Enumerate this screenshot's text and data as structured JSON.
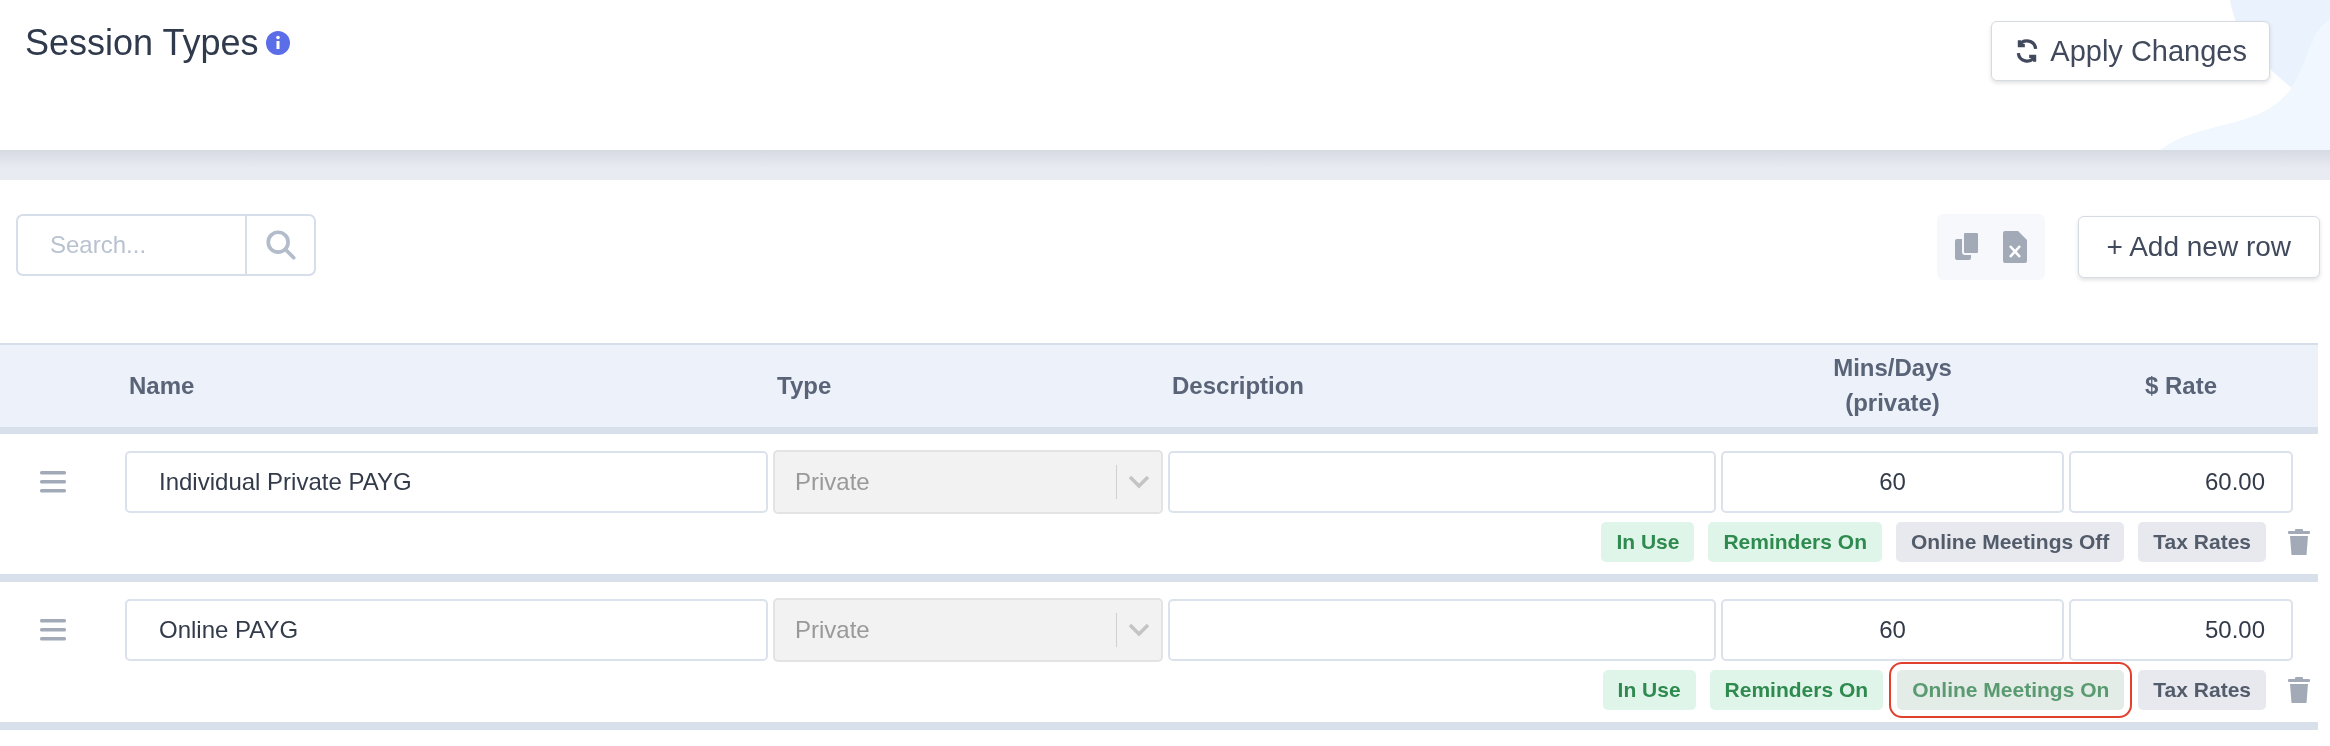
{
  "header": {
    "title": "Session Types",
    "apply_button": "Apply Changes"
  },
  "toolbar": {
    "search": {
      "placeholder": "Search..."
    },
    "add_button": "+ Add new row"
  },
  "table": {
    "columns": [
      "Name",
      "Type",
      "Description",
      "Mins/Days\n(private)",
      "$ Rate"
    ],
    "rows": [
      {
        "name": "Individual Private PAYG",
        "type": {
          "value": "Private",
          "disabled": true
        },
        "description": "",
        "mins": "60",
        "rate": "60.00",
        "tags": [
          {
            "label": "In Use",
            "active": true,
            "highlighted": false
          },
          {
            "label": "Reminders On",
            "active": true,
            "highlighted": false
          },
          {
            "label": "Online Meetings Off",
            "active": false,
            "highlighted": false
          },
          {
            "label": "Tax Rates",
            "active": false,
            "highlighted": false
          }
        ]
      },
      {
        "name": "Online PAYG",
        "type": {
          "value": "Private",
          "disabled": true
        },
        "description": "",
        "mins": "60",
        "rate": "50.00",
        "tags": [
          {
            "label": "In Use",
            "active": true,
            "highlighted": false
          },
          {
            "label": "Reminders On",
            "active": true,
            "highlighted": false
          },
          {
            "label": "Online Meetings On",
            "active": true,
            "highlighted": true
          },
          {
            "label": "Tax Rates",
            "active": false,
            "highlighted": false
          }
        ]
      }
    ]
  }
}
